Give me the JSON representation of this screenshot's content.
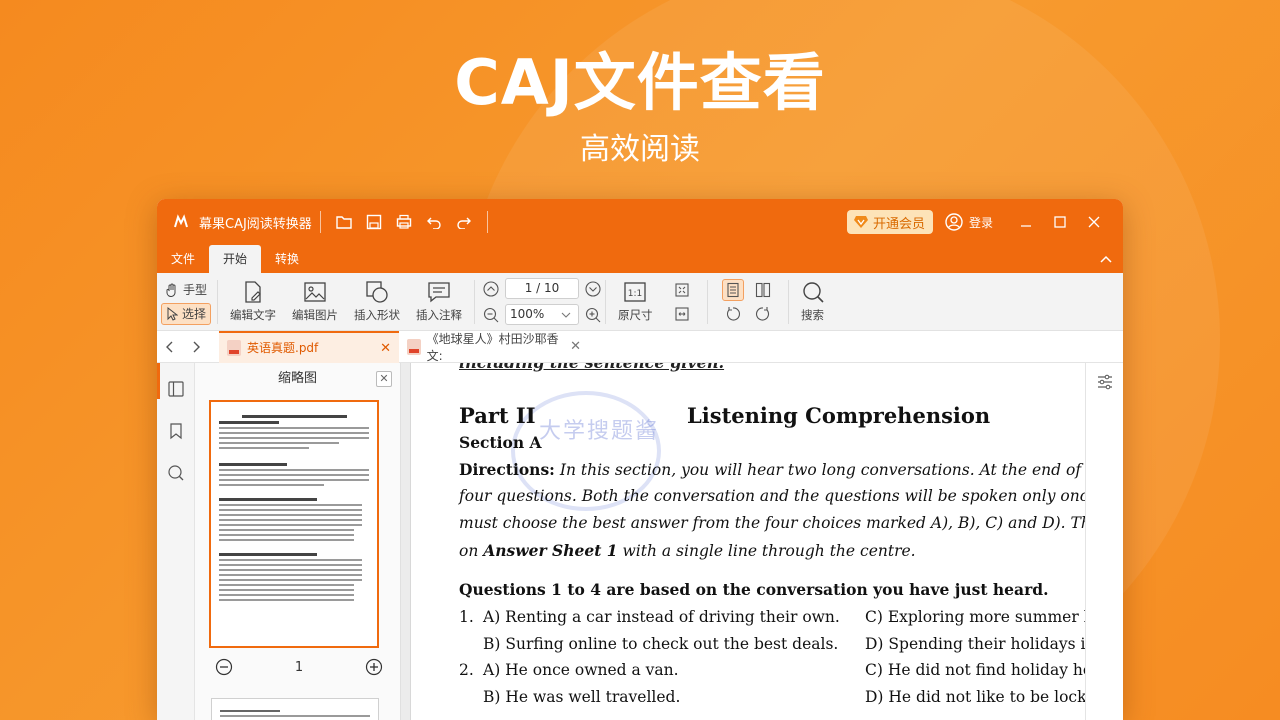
{
  "hero": {
    "title": "CAJ文件查看",
    "subtitle": "高效阅读"
  },
  "window": {
    "app_name": "幕果CAJ阅读转换器",
    "vip_label": "开通会员",
    "login_label": "登录"
  },
  "menu": {
    "items": [
      "文件",
      "开始",
      "转换"
    ],
    "active_index": 1
  },
  "ribbon": {
    "hand": "手型",
    "select": "选择",
    "edit_text": "编辑文字",
    "edit_image": "编辑图片",
    "insert_shape": "插入形状",
    "insert_note": "插入注释",
    "page_indicator": "1 / 10",
    "zoom": "100%",
    "original_size": "原尺寸",
    "search": "搜索"
  },
  "tabs": [
    {
      "label": "英语真题.pdf",
      "active": true
    },
    {
      "label": "《地球星人》村田沙耶香文:",
      "active": false
    }
  ],
  "thumbnail": {
    "title": "缩略图",
    "page_number": "1"
  },
  "document": {
    "cut_line": "including the sentence given.",
    "stamp": "大学搜题酱",
    "part": "Part II",
    "part_heading": "Listening Comprehension",
    "section": "Section A",
    "directions_label": "Directions:",
    "directions_lines": [
      "In this section, you will hear two long conversations. At the end of each convers",
      "four questions. Both the conversation and the questions will be spoken only once. After you h",
      "must choose the best answer from the four choices marked A), B), C) and D). Then mark the c"
    ],
    "directions_last_pre": "on",
    "directions_last_bold": "Answer Sheet 1",
    "directions_last_post": "with a single line through the centre.",
    "questions_heading": "Questions 1 to 4 are based on the conversation you have just heard.",
    "q1_num": "1.",
    "q1_a": "A) Renting a car instead of driving their own.",
    "q1_b": "B) Surfing online to check out the best deals.",
    "q1_c": "C) Exploring more summer holida",
    "q1_d": "D) Spending their holidays in a no",
    "q2_num": "2.",
    "q2_a": "A) He once owned a van.",
    "q2_b": "B) He was well travelled.",
    "q2_c": "C) He did not find holiday homes",
    "q2_d": "D) He did not like to be locked in"
  },
  "colors": {
    "brand": "#f06a0e",
    "hero_bg": "#f58a1f"
  }
}
